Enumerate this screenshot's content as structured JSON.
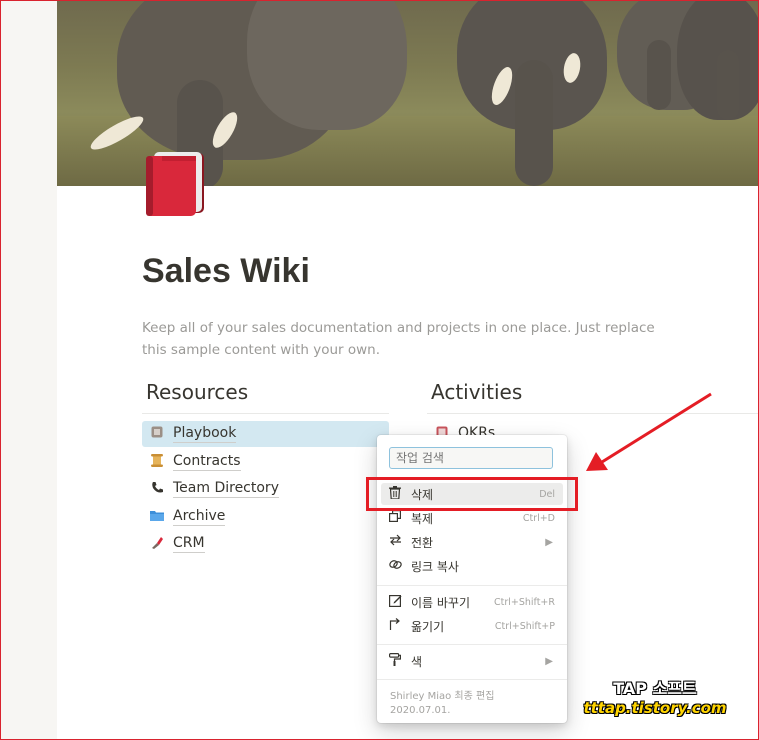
{
  "page": {
    "title": "Sales Wiki",
    "description": "Keep all of your sales documentation and projects in one place. Just replace this sample content with your own.",
    "icon": "red-book-icon"
  },
  "columns": {
    "resources": {
      "title": "Resources",
      "items": [
        {
          "label": "Playbook",
          "icon": "page-icon"
        },
        {
          "label": "Contracts",
          "icon": "scroll-icon"
        },
        {
          "label": "Team Directory",
          "icon": "telephone-icon"
        },
        {
          "label": "Archive",
          "icon": "folder-icon"
        },
        {
          "label": "CRM",
          "icon": "lipstick-icon"
        }
      ]
    },
    "activities": {
      "title": "Activities",
      "items": [
        {
          "label": "OKRs",
          "icon": "notebook-icon"
        }
      ]
    }
  },
  "context_menu": {
    "search_placeholder": "작업 검색",
    "items": [
      {
        "label": "삭제",
        "shortcut": "Del",
        "icon": "trash-icon"
      },
      {
        "label": "복제",
        "shortcut": "Ctrl+D",
        "icon": "duplicate-icon"
      },
      {
        "label": "전환",
        "icon": "convert-icon",
        "submenu": true
      },
      {
        "label": "링크 복사",
        "icon": "link-icon"
      },
      {
        "label": "이름 바꾸기",
        "shortcut": "Ctrl+Shift+R",
        "icon": "rename-icon"
      },
      {
        "label": "옮기기",
        "shortcut": "Ctrl+Shift+P",
        "icon": "move-icon"
      },
      {
        "label": "색",
        "icon": "paint-roller-icon",
        "submenu": true
      }
    ],
    "footer": {
      "edited_by": "Shirley Miao 최종 편집",
      "date": "2020.07.01."
    }
  },
  "watermark": {
    "line1": "TAP 소프트",
    "line2": "tttap.tistory.com"
  },
  "colors": {
    "highlight_row": "#d3e8f1",
    "annotation_red": "#e41d25",
    "title_text": "#37352f"
  }
}
